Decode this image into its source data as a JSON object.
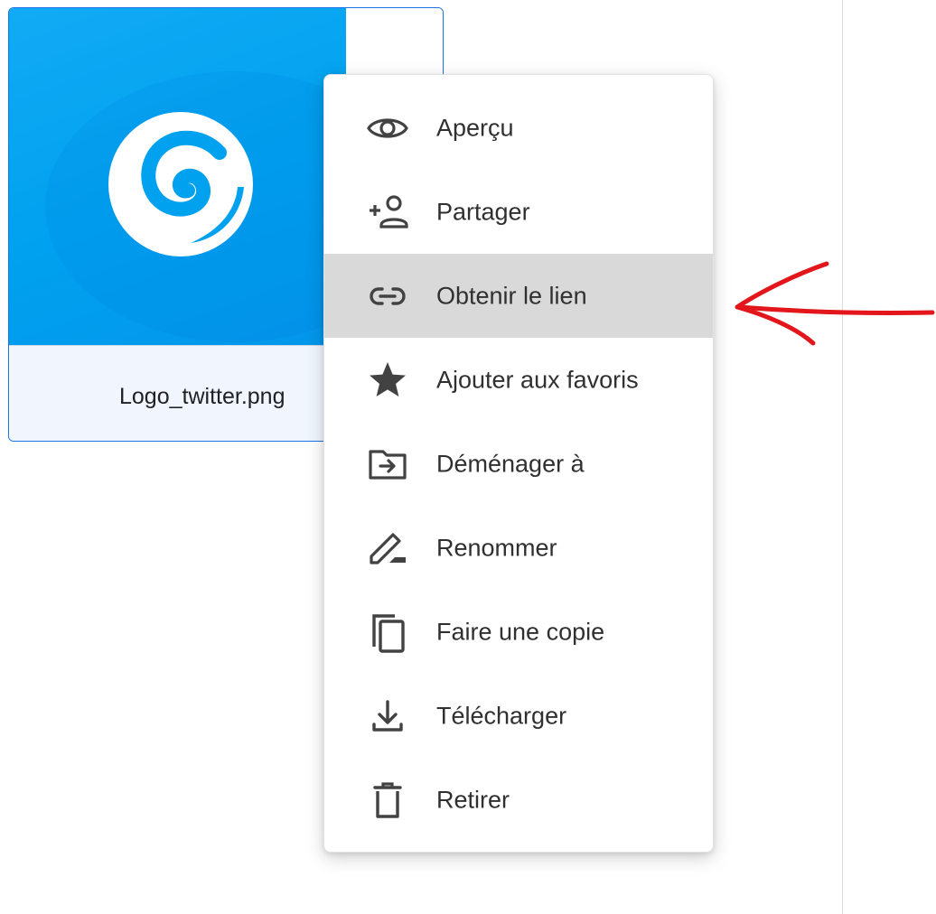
{
  "file": {
    "name": "Logo_twitter.png",
    "thumbnail_icon": "swirl-logo-icon",
    "accent_color": "#00a1ef"
  },
  "context_menu": {
    "items": [
      {
        "label": "Aperçu",
        "icon": "eye-icon"
      },
      {
        "label": "Partager",
        "icon": "person-add-icon"
      },
      {
        "label": "Obtenir le lien",
        "icon": "link-icon",
        "highlighted": true
      },
      {
        "label": "Ajouter aux favoris",
        "icon": "star-icon"
      },
      {
        "label": "Déménager à",
        "icon": "folder-move-icon"
      },
      {
        "label": "Renommer",
        "icon": "pencil-icon"
      },
      {
        "label": "Faire une copie",
        "icon": "copy-icon"
      },
      {
        "label": "Télécharger",
        "icon": "download-icon"
      },
      {
        "label": "Retirer",
        "icon": "trash-icon"
      }
    ],
    "highlight_color": "#d9d9d9"
  },
  "annotation": {
    "icon": "red-arrow-icon",
    "color": "#e2161b"
  }
}
